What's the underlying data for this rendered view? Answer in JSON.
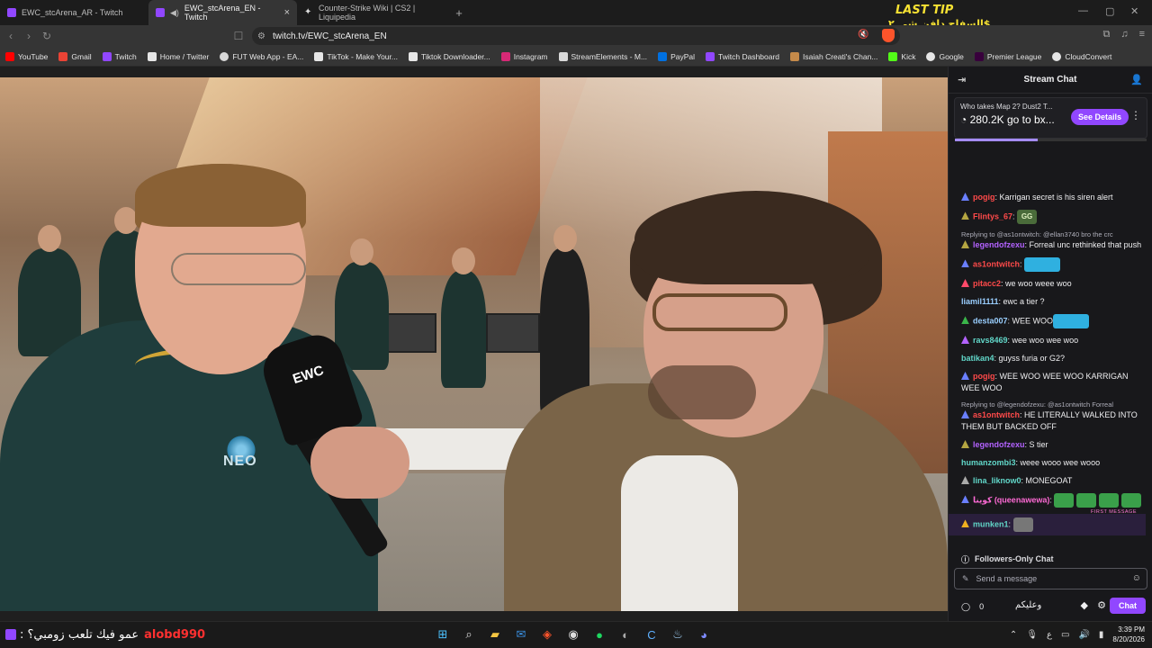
{
  "tabs": [
    {
      "title": "EWC_stcArena_AR - Twitch",
      "active": false
    },
    {
      "title": "EWC_stcArena_EN - Twitch",
      "active": true
    },
    {
      "title": "Counter-Strike Wiki | CS2 | Liquipedia",
      "active": false
    }
  ],
  "address": {
    "url": "twitch.tv/EWC_stcArena_EN"
  },
  "bookmarks": [
    {
      "label": "YouTube",
      "color": "#ff0000"
    },
    {
      "label": "Gmail",
      "color": "#ea4335"
    },
    {
      "label": "Twitch",
      "color": "#9147ff"
    },
    {
      "label": "Home / Twitter",
      "color": "#e6e6e6"
    },
    {
      "label": "FUT Web App - EA...",
      "color": "#d9d9d9"
    },
    {
      "label": "TikTok - Make Your...",
      "color": "#e6e6e6"
    },
    {
      "label": "Tiktok Downloader...",
      "color": "#e6e6e6"
    },
    {
      "label": "Instagram",
      "color": "#d62976"
    },
    {
      "label": "StreamElements - M...",
      "color": "#d9d9d9"
    },
    {
      "label": "PayPal",
      "color": "#0070e0"
    },
    {
      "label": "Twitch Dashboard",
      "color": "#9147ff"
    },
    {
      "label": "Isaiah Creati's Chan...",
      "color": "#c58a4a"
    },
    {
      "label": "Kick",
      "color": "#53fc18"
    },
    {
      "label": "Google",
      "color": "#e6e6e6"
    },
    {
      "label": "Premier League",
      "color": "#38003c"
    },
    {
      "label": "CloudConvert",
      "color": "#e6e6e6"
    }
  ],
  "overlay": {
    "last_tip_title": "LAST TIP",
    "last_tip_sub": "السفاح دافن شي ٢$",
    "bottom_user": "alobd990",
    "bottom_text": "عمو فيك تلعب زومبي؟ :"
  },
  "video": {
    "mic_label": "EWC",
    "shirt_label": "NEO"
  },
  "chat": {
    "header": "Stream Chat",
    "prediction": {
      "question": "Who takes Map 2? Dust2 T...",
      "points": "280.2K go to bx...",
      "details_label": "See Details",
      "progress": 0.43
    },
    "messages": [
      {
        "badge_color": "#6a7fff",
        "user": "pogig",
        "user_color": "#ff4a4a",
        "text": ": Karrigan secret is his siren alert",
        "reply": ""
      },
      {
        "badge_color": "#b5a642",
        "user": "Flintys_67",
        "user_color": "#ff4a4a",
        "text": ": ",
        "emote": "GG",
        "reply": ""
      },
      {
        "badge_color": "#b5a642",
        "user": "legendofzexu",
        "user_color": "#b362ff",
        "text": ": Forreal unc rethinked that push",
        "reply": "Replying to @as1ontwitch: @ellan3740 bro the crc"
      },
      {
        "badge_color": "#6a7fff",
        "user": "as1ontwitch",
        "user_color": "#ff4a4a",
        "text": ": ",
        "emote": "car",
        "reply": ""
      },
      {
        "badge_color": "#ff4a6a",
        "user": "pitacc2",
        "user_color": "#ff4a4a",
        "text": ": we woo weee woo",
        "reply": ""
      },
      {
        "badge_color": "",
        "user": "liamil1111",
        "user_color": "#9acfff",
        "text": ": ewc a tier ?",
        "reply": ""
      },
      {
        "badge_color": "#3ab54a",
        "user": "desta007",
        "user_color": "#9acfff",
        "text": ": WEE WOO",
        "emote": "car",
        "reply": ""
      },
      {
        "badge_color": "#b362ff",
        "user": "ravs8469",
        "user_color": "#61d6c8",
        "text": ": wee woo wee woo",
        "reply": ""
      },
      {
        "badge_color": "",
        "user": "batikan4",
        "user_color": "#61d6c8",
        "text": ": guyss furia or G2?",
        "reply": ""
      },
      {
        "badge_color": "#6a7fff",
        "user": "pogig",
        "user_color": "#ff4a4a",
        "text": ": WEE WOO WEE WOO KARRIGAN WEE WOO",
        "reply": ""
      },
      {
        "badge_color": "#6a7fff",
        "user": "as1ontwitch",
        "user_color": "#ff4a4a",
        "text": ": HE LITERALLY WALKED INTO THEM BUT BACKED OFF",
        "reply": "Replying to @legendofzexu: @as1ontwitch Forreal"
      },
      {
        "badge_color": "#b5a642",
        "user": "legendofzexu",
        "user_color": "#b362ff",
        "text": ": S tier",
        "reply": ""
      },
      {
        "badge_color": "",
        "user": "humanzombi3",
        "user_color": "#61d6c8",
        "text": ": weee wooo wee wooo",
        "reply": ""
      },
      {
        "badge_color": "#aaaaaa",
        "user": "lina_liknow0",
        "user_color": "#61d6c8",
        "text": ": MONEGOAT",
        "reply": ""
      },
      {
        "badge_color": "#6a7fff",
        "user": "كوينا (queenawewa)",
        "user_color": "#ff6ad5",
        "text": ": ",
        "emote": "pepes",
        "reply": ""
      },
      {
        "badge_color": "#f0b020",
        "user": "munken1",
        "user_color": "#61d6c8",
        "text": ": ",
        "emote": "face",
        "reply": "",
        "first": "FIRST MESSAGE"
      }
    ],
    "followers_only": "Followers-Only Chat",
    "input_placeholder": "Send a message",
    "points_count": "0",
    "footer_rtl": "وعليكم",
    "chat_button": "Chat"
  },
  "taskbar": {
    "time": "3:39 PM",
    "date": "8/20/2026"
  }
}
